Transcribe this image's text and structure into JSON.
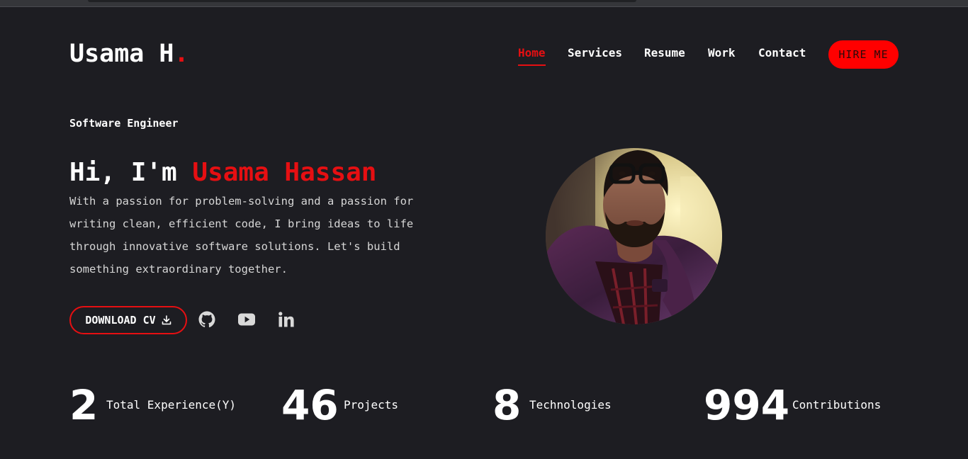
{
  "header": {
    "logo_text": "Usama H",
    "logo_dot": ".",
    "nav": [
      {
        "label": "Home",
        "active": true
      },
      {
        "label": "Services"
      },
      {
        "label": "Resume"
      },
      {
        "label": "Work"
      },
      {
        "label": "Contact"
      }
    ],
    "hire_label": "HIRE ME"
  },
  "hero": {
    "role": "Software Engineer",
    "greeting": "Hi, I'm ",
    "name": "Usama Hassan",
    "description": "With a passion for problem-solving and a passion for writing clean, efficient code, I bring ideas to life through innovative software solutions. Let's build something extraordinary together.",
    "cv_label": "DOWNLOAD CV",
    "socials": [
      "github-icon",
      "youtube-icon",
      "linkedin-icon"
    ]
  },
  "stats": [
    {
      "value": "2",
      "label": "Total Experience(Y)"
    },
    {
      "value": "46",
      "label": "Projects"
    },
    {
      "value": "8",
      "label": "Technologies"
    },
    {
      "value": "994",
      "label": "Contributions"
    }
  ],
  "colors": {
    "accent": "#e60f12",
    "background": "#1d1d22",
    "hire_bg": "#ff0000"
  }
}
